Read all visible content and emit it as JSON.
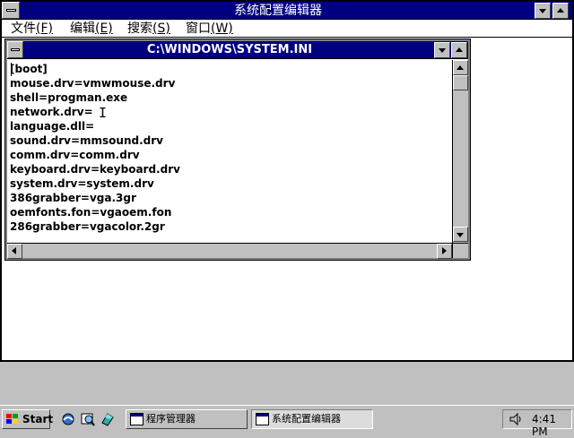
{
  "main_window": {
    "title": "系统配置编辑器",
    "menu": [
      {
        "label": "文件",
        "accel": "(F)"
      },
      {
        "label": "编辑",
        "accel": "(E)"
      },
      {
        "label": "搜索",
        "accel": "(S)"
      },
      {
        "label": "窗口",
        "accel": "(W)"
      }
    ]
  },
  "document": {
    "title": "C:\\WINDOWS\\SYSTEM.INI",
    "lines": [
      "[boot]",
      "mouse.drv=vmwmouse.drv",
      "shell=progman.exe",
      "network.drv=",
      "language.dll=",
      "sound.drv=mmsound.drv",
      "comm.drv=comm.drv",
      "keyboard.drv=keyboard.drv",
      "system.drv=system.drv",
      "386grabber=vga.3gr",
      "oemfonts.fon=vgaoem.fon",
      "286grabber=vgacolor.2gr"
    ]
  },
  "taskbar": {
    "start_label": "Start",
    "tasks": [
      {
        "label": "程序管理器",
        "active": false
      },
      {
        "label": "系统配置编辑器",
        "active": true
      }
    ],
    "clock": "4:41 PM"
  },
  "icons": {
    "quick_launch": [
      "internet-explorer-icon",
      "search-icon",
      "channels-icon"
    ],
    "tray": "speaker-icon"
  },
  "colors": {
    "title_active": "#000080",
    "face": "#c0c0c0",
    "window": "#ffffff"
  }
}
